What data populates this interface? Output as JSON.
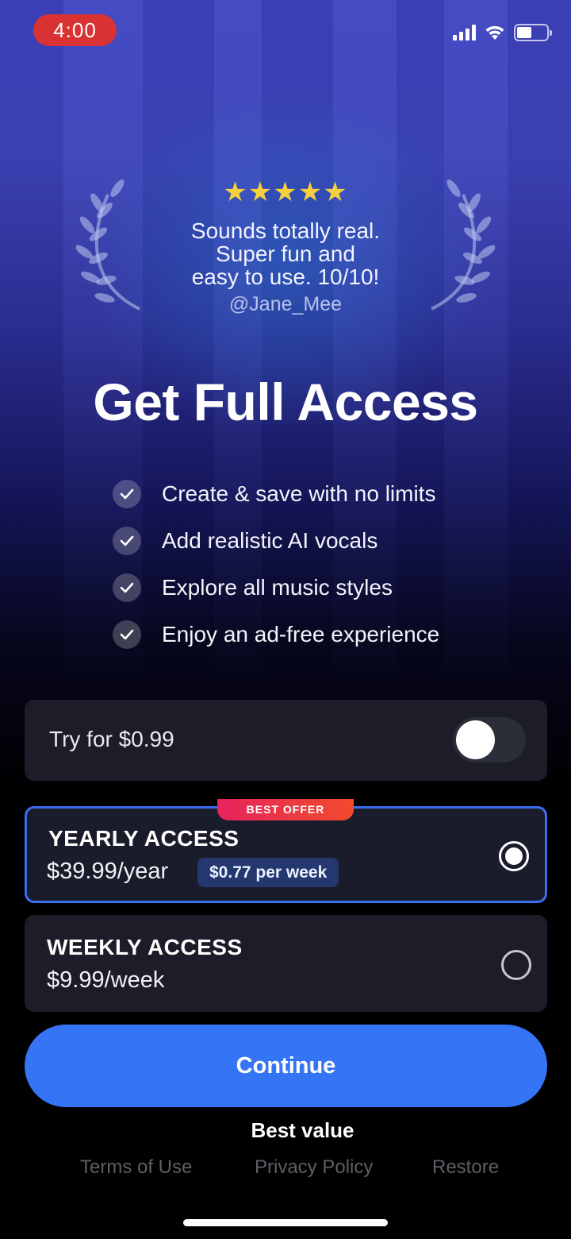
{
  "status_bar": {
    "time": "4:00"
  },
  "review": {
    "stars": "★★★★★",
    "lines": [
      "Sounds totally real.",
      "Super fun and",
      "easy to use. 10/10!"
    ],
    "author": "@Jane_Mee"
  },
  "title": "Get Full Access",
  "features": [
    "Create & save with no limits",
    "Add realistic AI vocals",
    "Explore all music styles",
    "Enjoy an ad-free experience"
  ],
  "trial": {
    "label": "Try for $0.99",
    "enabled": false
  },
  "plans": [
    {
      "name": "YEARLY ACCESS",
      "price": "$39.99/year",
      "per_week": "$0.77 per week",
      "badge": "BEST OFFER",
      "selected": true
    },
    {
      "name": "WEEKLY ACCESS",
      "price": "$9.99/week",
      "selected": false
    }
  ],
  "continue_label": "Continue",
  "subtitle": "Best value",
  "footer": {
    "terms": "Terms of Use",
    "privacy": "Privacy Policy",
    "restore": "Restore"
  },
  "colors": {
    "accent": "#3574f5",
    "star": "#f5cf3d",
    "time_pill": "#d93232",
    "badge_start": "#e5245c",
    "badge_end": "#f24a2d"
  }
}
